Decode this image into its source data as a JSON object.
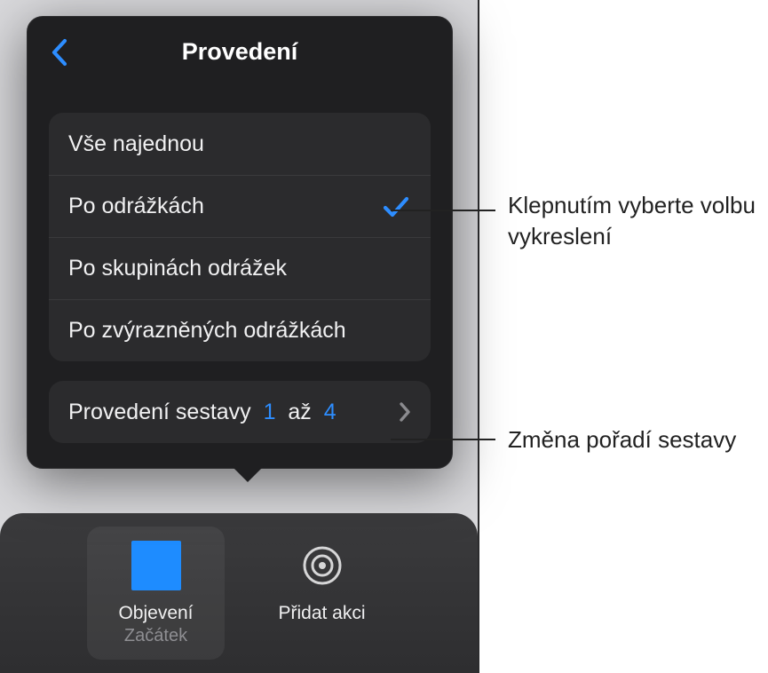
{
  "popover": {
    "title": "Provedení",
    "options": [
      {
        "label": "Vše najednou",
        "checked": false
      },
      {
        "label": "Po odrážkách",
        "checked": true
      },
      {
        "label": "Po skupinách odrážek",
        "checked": false
      },
      {
        "label": "Po zvýrazněných odrážkách",
        "checked": false
      }
    ],
    "sequence": {
      "prefix": "Provedení sestavy",
      "from": "1",
      "mid": "až",
      "to": "4"
    }
  },
  "toolbar": {
    "selected": {
      "title": "Objevení",
      "sub": "Začátek"
    },
    "add": {
      "label": "Přidat akci"
    }
  },
  "callouts": {
    "a": "Klepnutím vyberte volbu vykreslení",
    "b": "Změna pořadí sestavy"
  }
}
